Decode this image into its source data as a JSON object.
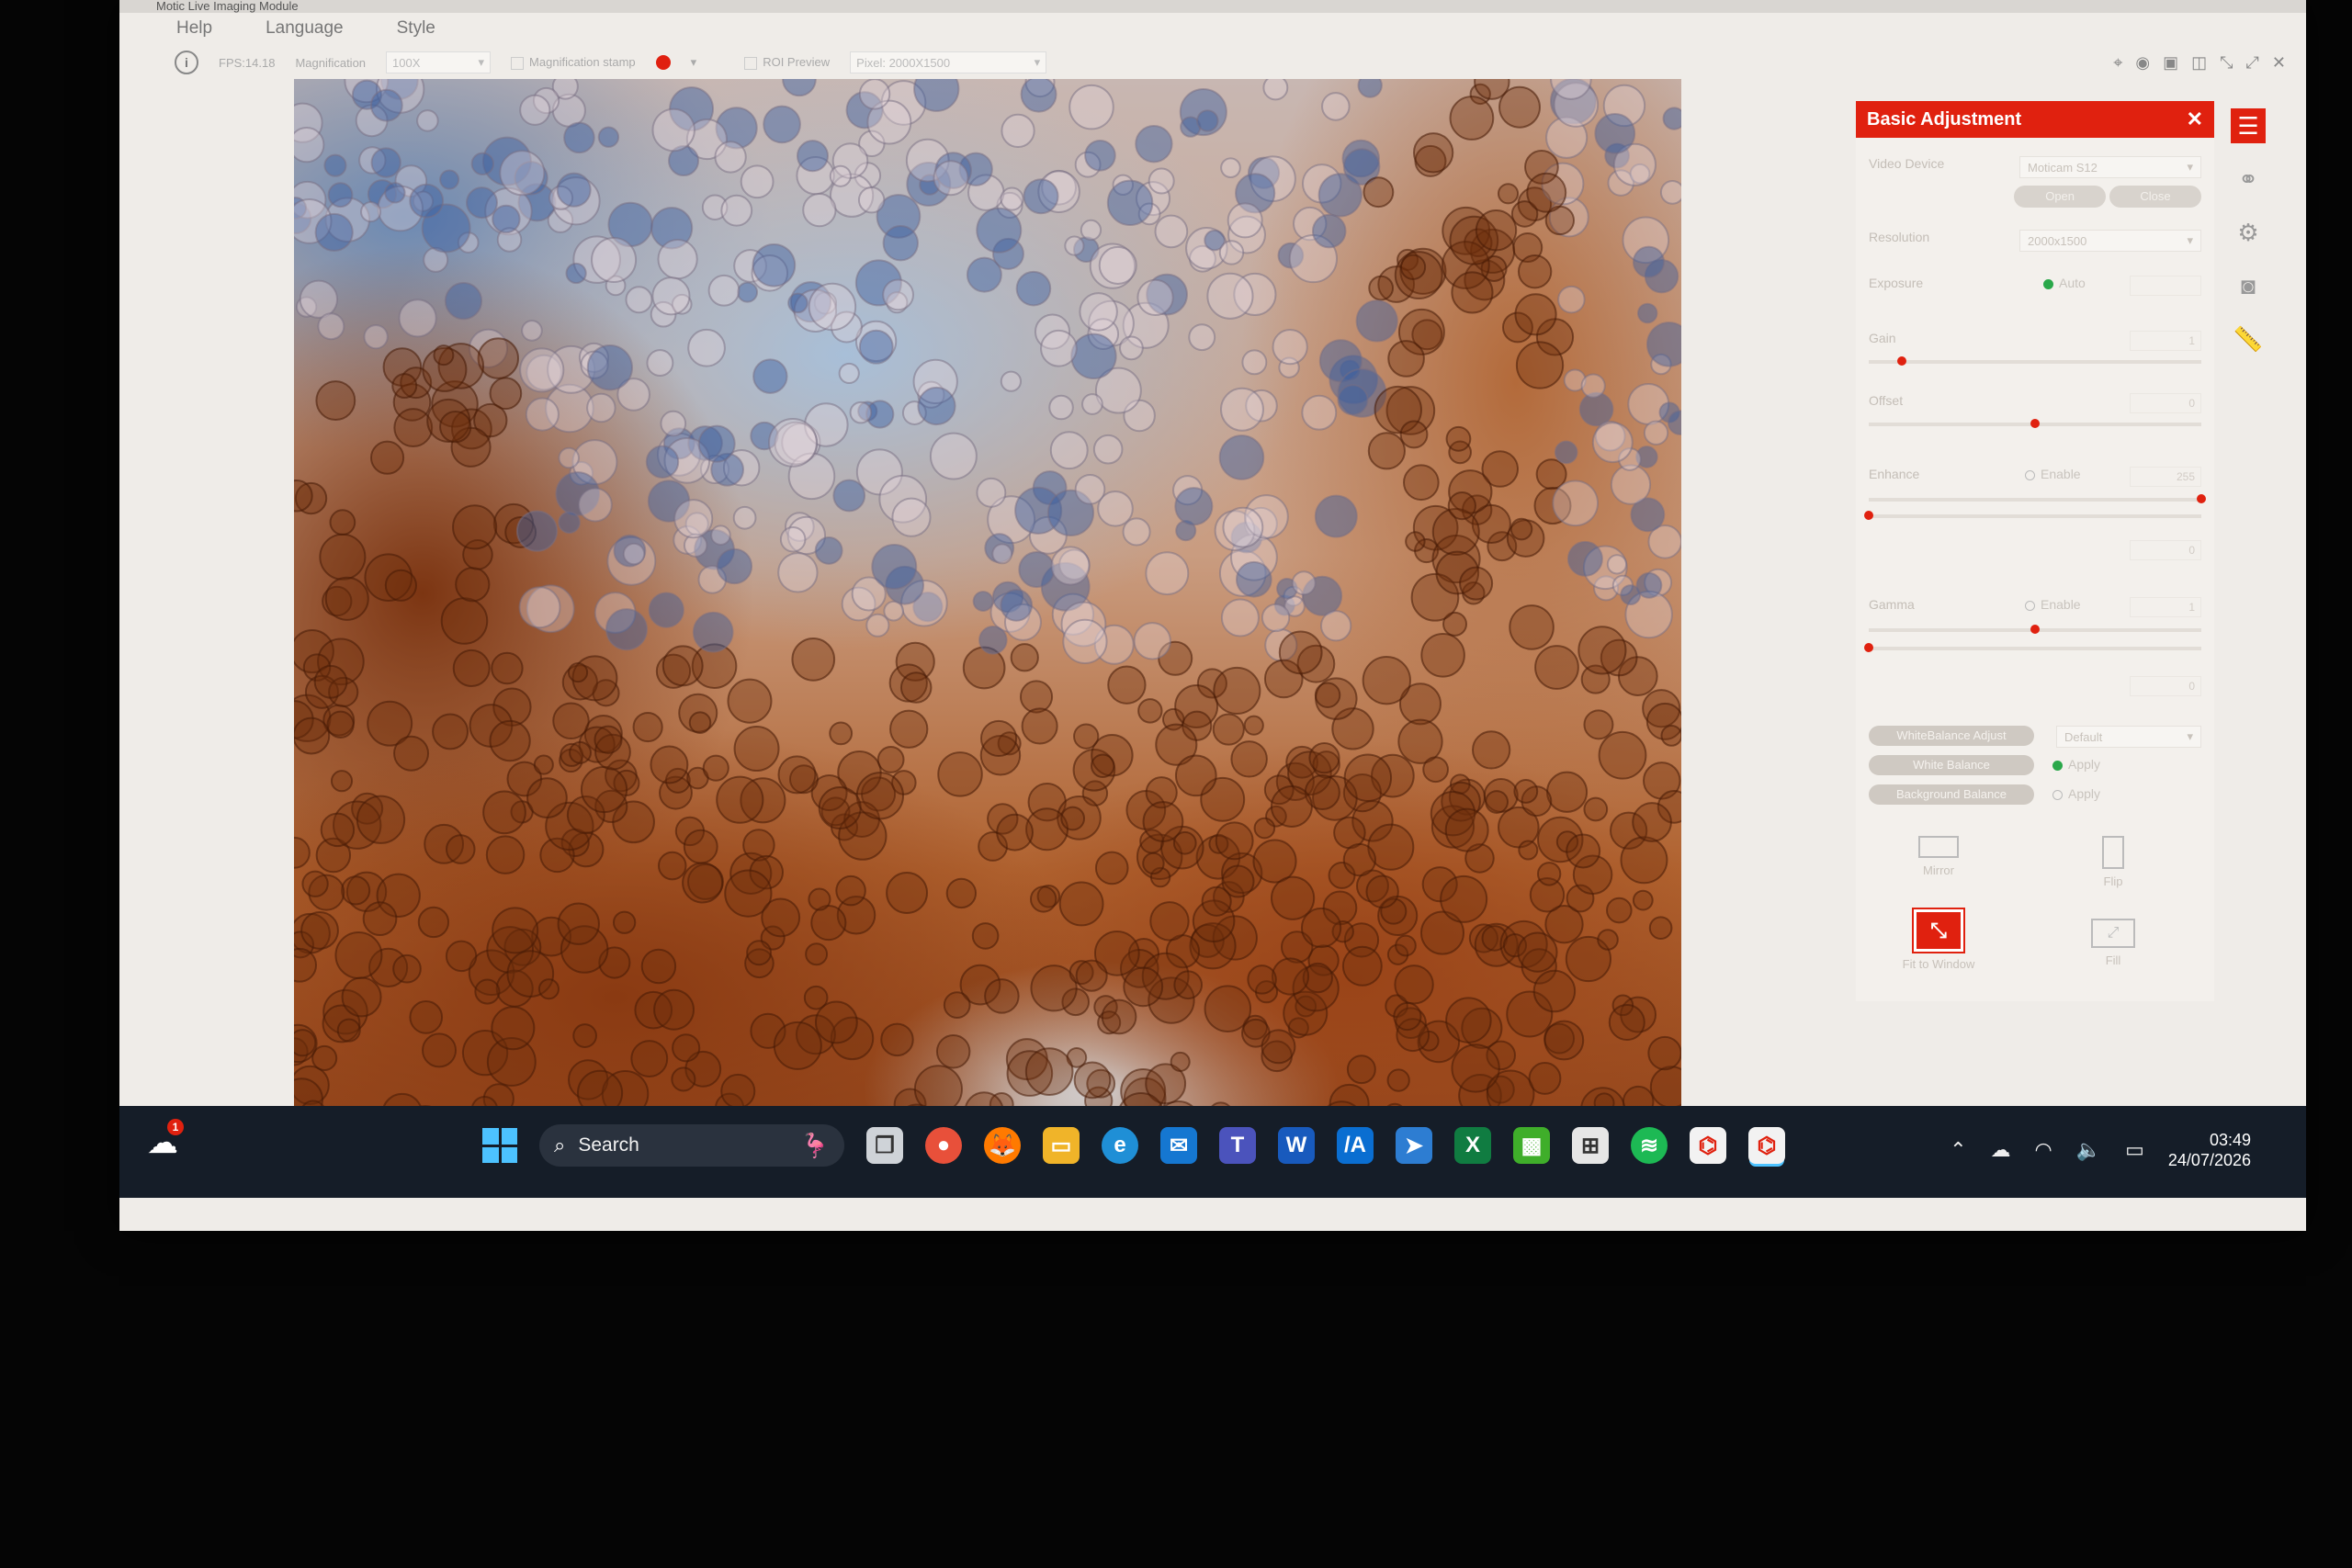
{
  "window": {
    "title": "Motic Live Imaging Module"
  },
  "menu": [
    "Help",
    "Language",
    "Style"
  ],
  "toolbar": {
    "fps": "FPS:14.18",
    "magnification_label": "Magnification",
    "magnification_value": "100X",
    "stamp_label": "Magnification stamp",
    "stamp_color": "#e0210f",
    "roi_label": "ROI Preview",
    "pixel_label": "Pixel: 2000X1500"
  },
  "panel": {
    "title": "Basic Adjustment",
    "video_device_label": "Video Device",
    "video_device_value": "Moticam S12",
    "open_button": "Open",
    "close_button": "Close",
    "resolution_label": "Resolution",
    "resolution_value": "2000x1500",
    "exposure_label": "Exposure",
    "exposure_auto": "Auto",
    "gain_label": "Gain",
    "gain_value": "1",
    "gain_level": 0.1,
    "offset_label": "Offset",
    "offset_value": "0",
    "offset_level": 0.5,
    "enhance_label": "Enhance",
    "enhance_enable": "Enable",
    "enhance_value": "255",
    "enhance_level": 1.0,
    "enhance2_value": "0",
    "enhance2_level": 0.0,
    "gamma_label": "Gamma",
    "gamma_enable": "Enable",
    "gamma_value": "1",
    "gamma_level": 0.5,
    "gamma2_value": "0",
    "gamma2_level": 0.0,
    "wb_adjust": "WhiteBalance Adjust",
    "wb_mode": "Default",
    "white_balance": "White Balance",
    "apply": "Apply",
    "background_balance": "Background Balance",
    "mirror": "Mirror",
    "flip": "Flip",
    "fit_to_window": "Fit to Window",
    "fill": "Fill"
  },
  "taskbar": {
    "search_placeholder": "Search",
    "weather_badge": "1",
    "time": "03:49",
    "date": "24/07/2026"
  },
  "colors": {
    "accent": "#e0210f",
    "taskbar": "#151d28",
    "stain_brown": "#9a4418",
    "stain_blue": "#6c8ab3"
  }
}
